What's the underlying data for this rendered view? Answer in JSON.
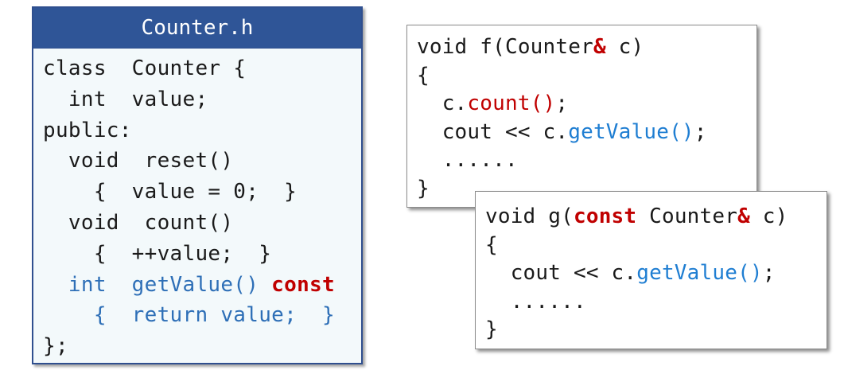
{
  "header_file": {
    "title": "Counter.h",
    "lines": [
      [
        {
          "t": "class  Counter {",
          "c": "kw"
        }
      ],
      [
        {
          "t": "  int  value;",
          "c": "kw"
        }
      ],
      [
        {
          "t": "public:",
          "c": "kw"
        }
      ],
      [
        {
          "t": "  void  reset()",
          "c": "kw"
        }
      ],
      [
        {
          "t": "    {  value = 0;  }",
          "c": "kw"
        }
      ],
      [
        {
          "t": "  void  count()",
          "c": "kw"
        }
      ],
      [
        {
          "t": "    {  ++value;  }",
          "c": "kw"
        }
      ],
      [
        {
          "t": "  int  getValue() ",
          "c": "darkblue"
        },
        {
          "t": "const",
          "c": "red-bold"
        }
      ],
      [
        {
          "t": "    {  return value;  }",
          "c": "darkblue"
        }
      ],
      [
        {
          "t": "};",
          "c": "kw"
        }
      ]
    ]
  },
  "function_f": {
    "lines": [
      [
        {
          "t": "void f(Counter",
          "c": "kw"
        },
        {
          "t": "&",
          "c": "red-bold"
        },
        {
          "t": " c)",
          "c": "kw"
        }
      ],
      [
        {
          "t": "{",
          "c": "kw"
        }
      ],
      [
        {
          "t": "  c.",
          "c": "kw"
        },
        {
          "t": "count()",
          "c": "red"
        },
        {
          "t": ";",
          "c": "kw"
        }
      ],
      [
        {
          "t": "  cout << c.",
          "c": "kw"
        },
        {
          "t": "getValue()",
          "c": "blue"
        },
        {
          "t": ";",
          "c": "kw"
        }
      ],
      [
        {
          "t": "  ......",
          "c": "kw"
        }
      ],
      [
        {
          "t": "}",
          "c": "kw"
        }
      ]
    ]
  },
  "function_g": {
    "lines": [
      [
        {
          "t": "void g(",
          "c": "kw"
        },
        {
          "t": "const",
          "c": "red-bold"
        },
        {
          "t": " Counter",
          "c": "kw"
        },
        {
          "t": "&",
          "c": "red-bold"
        },
        {
          "t": " c)",
          "c": "kw"
        }
      ],
      [
        {
          "t": "{",
          "c": "kw"
        }
      ],
      [
        {
          "t": "  cout << c.",
          "c": "kw"
        },
        {
          "t": "getValue()",
          "c": "blue"
        },
        {
          "t": ";",
          "c": "kw"
        }
      ],
      [
        {
          "t": "  ......",
          "c": "kw"
        }
      ],
      [
        {
          "t": "}",
          "c": "kw"
        }
      ]
    ]
  },
  "colors": {
    "header_bar": "#2f5597",
    "header_panel_bg": "#f3f9fb",
    "keyword_red": "#c00000",
    "method_blue": "#1f7ed2",
    "const_method_blue": "#2e6fb7"
  }
}
